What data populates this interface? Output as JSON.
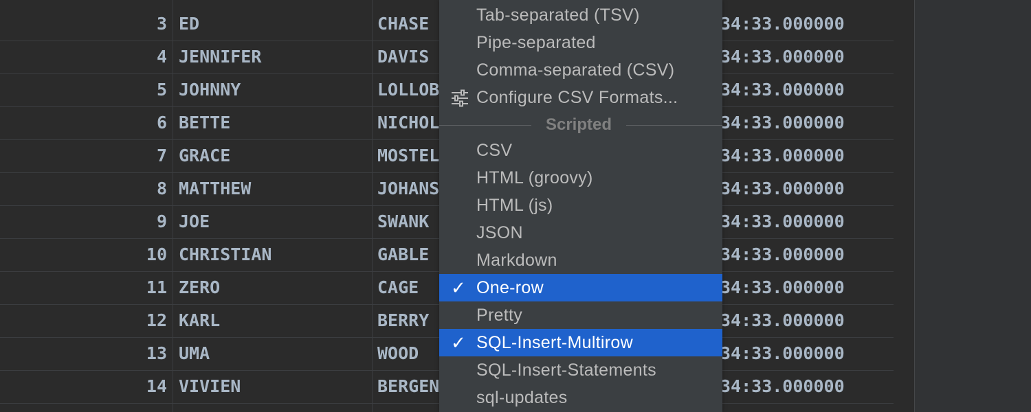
{
  "grid": {
    "rows": [
      {
        "id": "3",
        "first": "ED",
        "last": "CHASE",
        "date": "34:33.000000"
      },
      {
        "id": "4",
        "first": "JENNIFER",
        "last": "DAVIS",
        "date": "34:33.000000"
      },
      {
        "id": "5",
        "first": "JOHNNY",
        "last": "LOLLOB",
        "date": "34:33.000000"
      },
      {
        "id": "6",
        "first": "BETTE",
        "last": "NICHOL",
        "date": "34:33.000000"
      },
      {
        "id": "7",
        "first": "GRACE",
        "last": "MOSTEL",
        "date": "34:33.000000"
      },
      {
        "id": "8",
        "first": "MATTHEW",
        "last": "JOHANS",
        "date": "34:33.000000"
      },
      {
        "id": "9",
        "first": "JOE",
        "last": "SWANK",
        "date": "34:33.000000"
      },
      {
        "id": "10",
        "first": "CHRISTIAN",
        "last": "GABLE",
        "date": "34:33.000000"
      },
      {
        "id": "11",
        "first": "ZERO",
        "last": "CAGE",
        "date": "34:33.000000"
      },
      {
        "id": "12",
        "first": "KARL",
        "last": "BERRY",
        "date": "34:33.000000"
      },
      {
        "id": "13",
        "first": "UMA",
        "last": "WOOD",
        "date": "34:33.000000"
      },
      {
        "id": "14",
        "first": "VIVIEN",
        "last": "BERGEN",
        "date": "34:33.000000"
      }
    ]
  },
  "menu": {
    "items_top": [
      {
        "label": "Tab-separated (TSV)"
      },
      {
        "label": "Pipe-separated"
      },
      {
        "label": "Comma-separated (CSV)"
      },
      {
        "label": "Configure CSV Formats...",
        "icon": "sliders-icon"
      }
    ],
    "section_label": "Scripted",
    "items_scripted": [
      {
        "label": "CSV",
        "checked": false
      },
      {
        "label": "HTML (groovy)",
        "checked": false
      },
      {
        "label": "HTML (js)",
        "checked": false
      },
      {
        "label": "JSON",
        "checked": false
      },
      {
        "label": "Markdown",
        "checked": false
      },
      {
        "label": "One-row",
        "checked": true
      },
      {
        "label": "Pretty",
        "checked": false
      },
      {
        "label": "SQL-Insert-Multirow",
        "checked": true
      },
      {
        "label": "SQL-Insert-Statements",
        "checked": false
      },
      {
        "label": "sql-updates",
        "checked": false
      }
    ],
    "check_glyph": "✓"
  },
  "colors": {
    "background": "#2b2b2b",
    "menu_background": "#3b3f42",
    "selection": "#1f62cc",
    "grid_text": "#a9b7c6"
  }
}
